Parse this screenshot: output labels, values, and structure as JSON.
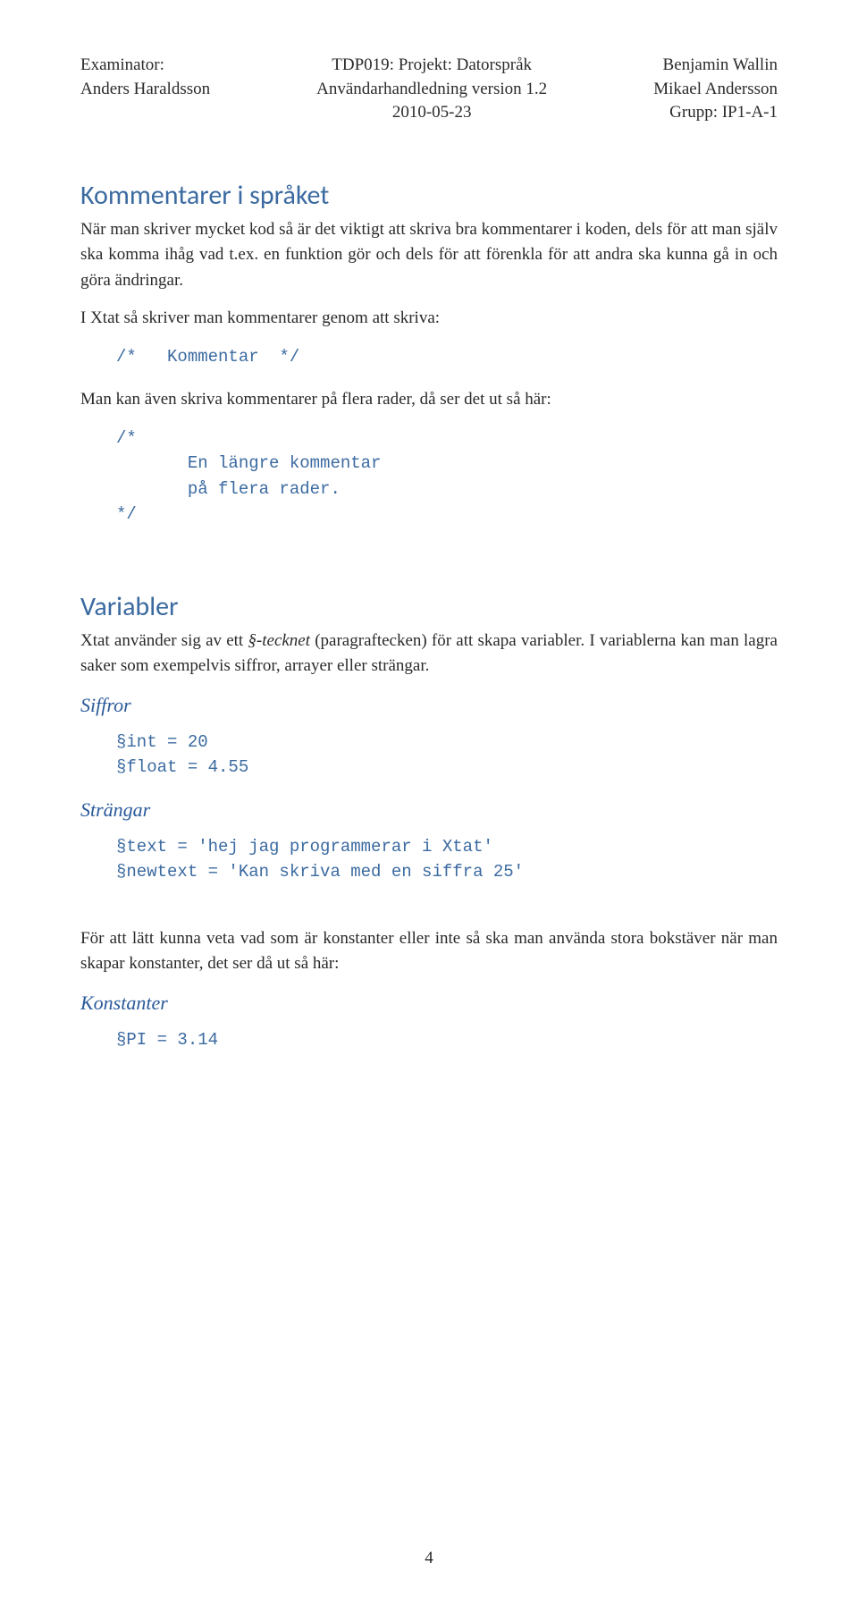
{
  "header": {
    "left": {
      "role": "Examinator:",
      "name": "Anders Haraldsson"
    },
    "center": {
      "course": "TDP019: Projekt: Datorspråk",
      "subtitle": "Användarhandledning version 1.2",
      "date": "2010-05-23"
    },
    "right": {
      "name1": "Benjamin Wallin",
      "name2": "Mikael Andersson",
      "group": "Grupp: IP1-A-1"
    }
  },
  "sections": {
    "kommentarer": {
      "title": "Kommentarer i språket",
      "p1": "När man skriver mycket kod så är det viktigt att skriva bra kommentarer i koden, dels för att man själv ska komma ihåg vad t.ex. en funktion gör och dels för att förenkla för att andra ska kunna gå in och göra ändringar.",
      "p2": "I Xtat så skriver man kommentarer genom att skriva:",
      "code1": "/*   Kommentar  */",
      "p3": "Man kan även skriva kommentarer på flera rader, då ser det ut så här:",
      "code2": "/*\n       En längre kommentar\n       på flera rader.\n*/"
    },
    "variabler": {
      "title": "Variabler",
      "p1_a": "Xtat använder sig av ett ",
      "p1_em": "§-tecknet",
      "p1_b": " (paragraftecken) för att skapa variabler. I variablerna kan man lagra saker som exempelvis siffror, arrayer eller strängar.",
      "siffror_label": "Siffror",
      "siffror_code": "§int = 20\n§float = 4.55",
      "strangar_label": "Strängar",
      "strangar_code": "§text = 'hej jag programmerar i Xtat'\n§newtext = 'Kan skriva med en siffra 25'",
      "p2": "För att lätt kunna veta vad som är konstanter eller inte så ska man använda stora bokstäver när man skapar konstanter, det ser då ut så här:",
      "konstanter_label": "Konstanter",
      "konstanter_code": "§PI = 3.14"
    }
  },
  "page_number": "4"
}
